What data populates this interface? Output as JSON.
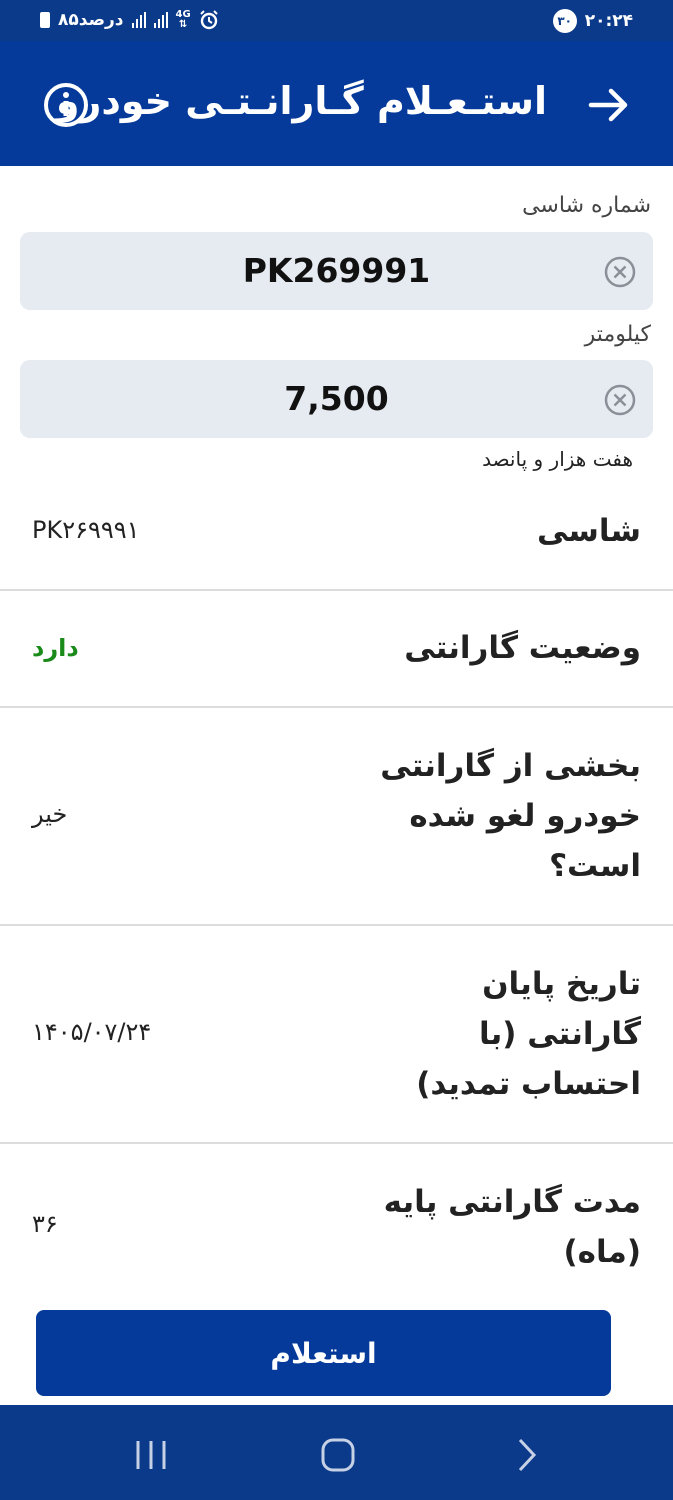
{
  "status_bar": {
    "battery_text": "۸۵درصد",
    "network_label": "4G",
    "time": "۲۰:۲۴",
    "notification_count": "۳۰"
  },
  "app_bar": {
    "title": "استـعـلام گـارانـتـی خودرو"
  },
  "form": {
    "chassis_label": "شماره شاسی",
    "chassis_value": "PK269991",
    "km_label": "کیلومتر",
    "km_value": "7,500",
    "km_words": "هفت هزار و پانصد"
  },
  "results": [
    {
      "label": "شاسی",
      "value": "PK۲۶۹۹۹۱"
    },
    {
      "label": "وضعیت گارانتی",
      "value": "دارد"
    },
    {
      "label_lines": [
        "بخشی از گارانتی",
        "خودرو لغو شده",
        "است؟"
      ],
      "value": "خیر"
    },
    {
      "label_lines": [
        "تاریخ پایان",
        "گارانتی (با",
        "احتساب تمدید)"
      ],
      "value": "۱۴۰۵/۰۷/۲۴"
    },
    {
      "label_lines": [
        "مدت گارانتی پایه",
        "(ماه)"
      ],
      "value": "۳۶"
    }
  ],
  "actions": {
    "inquiry_button": "استعلام"
  },
  "colors": {
    "brand": "#053a9a",
    "status_ok": "#1a8a1a",
    "input_bg": "#e6eaf1"
  }
}
